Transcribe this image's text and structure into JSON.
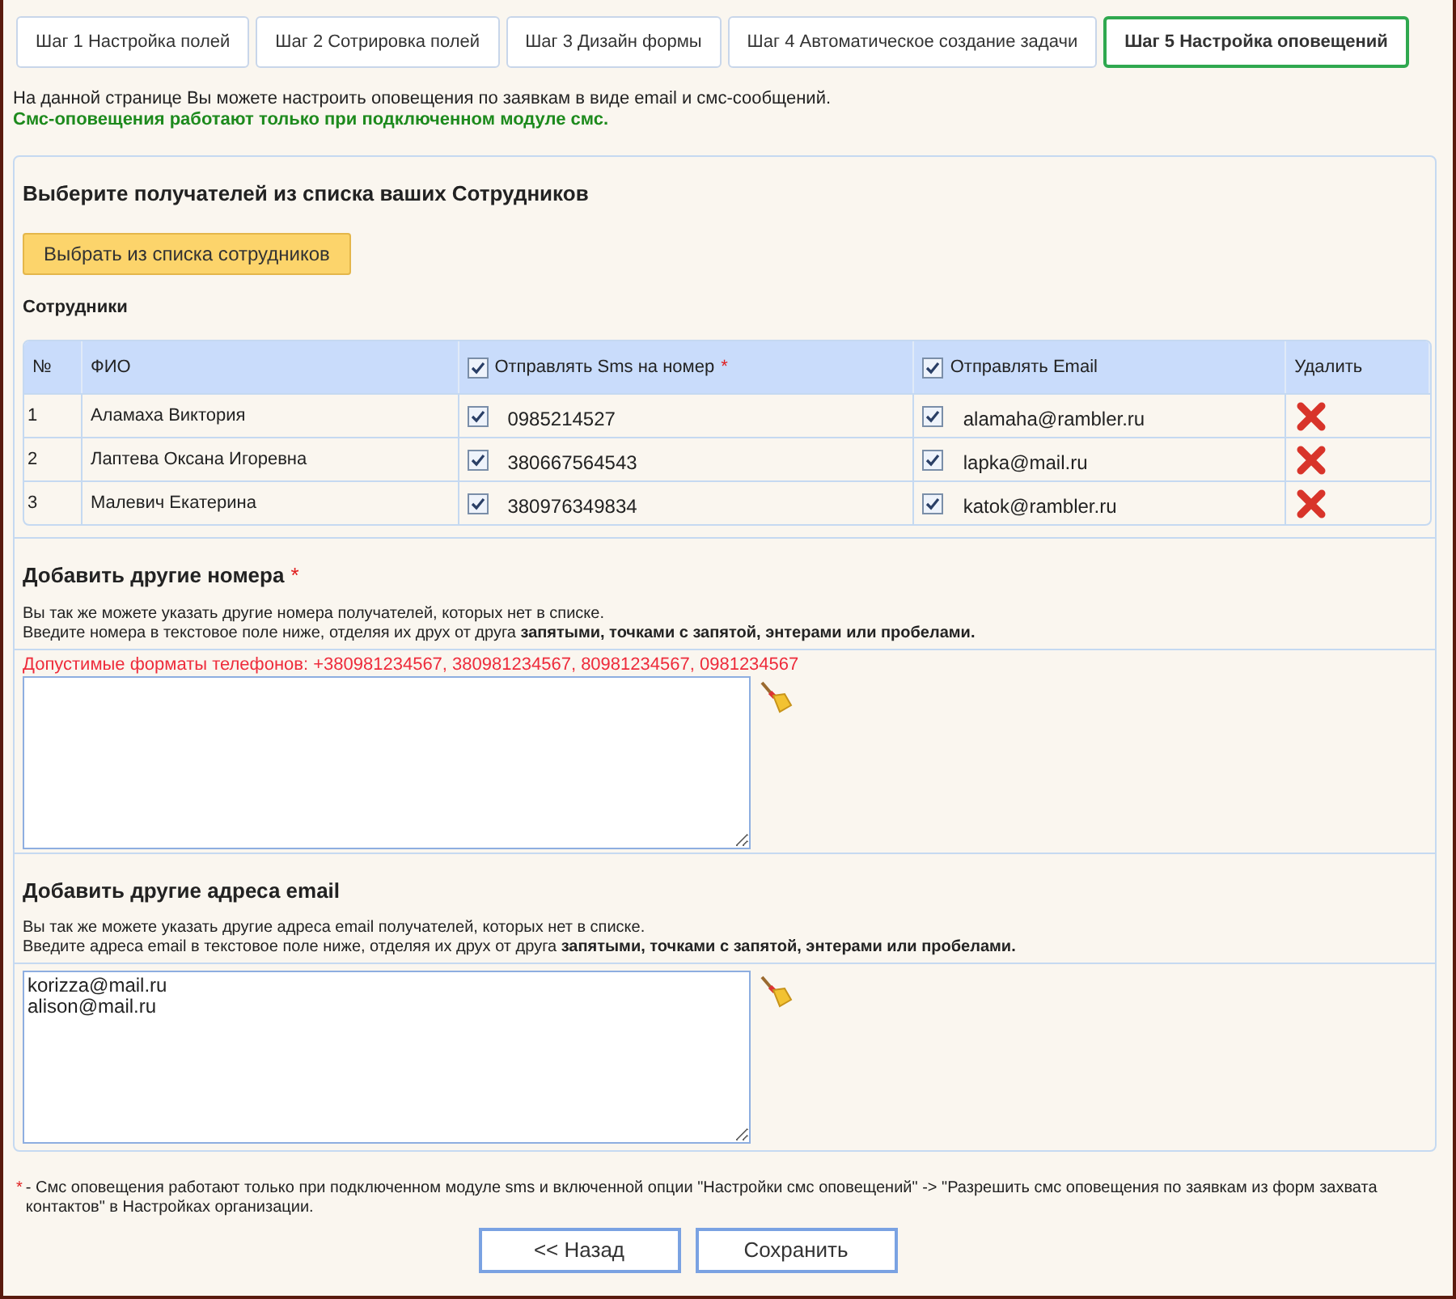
{
  "tabs": [
    {
      "label": "Шаг 1 Настройка полей",
      "selected": false
    },
    {
      "label": "Шаг 2 Сотрировка полей",
      "selected": false
    },
    {
      "label": "Шаг 3 Дизайн формы",
      "selected": false
    },
    {
      "label": "Шаг 4 Автоматическое создание задачи",
      "selected": false
    },
    {
      "label": "Шаг 5 Настройка оповещений",
      "selected": true
    }
  ],
  "intro": {
    "text": "На данной странице Вы можете настроить оповещения по заявкам в виде email и смс-сообщений.",
    "warning": "Смс-оповещения работают только при подключенном модуле смс."
  },
  "recipients": {
    "heading": "Выберите получателей из списка ваших Сотрудников",
    "pick_button": "Выбрать из списка сотрудников",
    "table_title": "Сотрудники",
    "columns": [
      {
        "label": "№"
      },
      {
        "label": "ФИО"
      },
      {
        "label": "Отправлять Sms на номер",
        "required_mark": "*",
        "checked": true
      },
      {
        "label": "Отправлять Email",
        "checked": true
      },
      {
        "label": "Удалить"
      }
    ],
    "rows": [
      {
        "number": "1",
        "name": "Аламаха Виктория",
        "sms_checked": true,
        "phone": "0985214527",
        "email_checked": true,
        "email": "alamaha@rambler.ru"
      },
      {
        "number": "2",
        "name": "Лаптева Оксана Игоревна",
        "sms_checked": true,
        "phone": "380667564543",
        "email_checked": true,
        "email": "lapka@mail.ru"
      },
      {
        "number": "3",
        "name": "Малевич Екатерина",
        "sms_checked": true,
        "phone": "380976349834",
        "email_checked": true,
        "email": "katok@rambler.ru"
      }
    ]
  },
  "phones": {
    "heading": "Добавить другие номера",
    "required_mark": "*",
    "description": [
      "Вы так же можете указать другие номера получателей, которых нет в списке.",
      "Введите номера в текстовое поле ниже, отделяя их друх от друга **запятыми, точками с запятой, энтерами или пробелами.**"
    ],
    "formats": "Допустимые форматы телефонов: +380981234567, 380981234567, 80981234567, 0981234567"
  },
  "emails": {
    "heading": "Добавить другие адреса email",
    "description": [
      "Вы так же можете указать другие адреса email получателей, которых нет в списке.",
      "Введите адреса email в текстовое поле ниже, отделяя их друх от друга **запятыми, точками с запятой, энтерами или пробелами.**"
    ],
    "value": "korizza@mail.ru\nalison@mail.ru"
  },
  "footnote": {
    "mark": "*",
    "text": " - Смс оповещения работают только при подключенном модуле sms и включенной опции \"Настройки смс оповещений\" -> \"Разрешить смс оповещения по заявкам из форм захвата контактов\" в Настройках организации."
  },
  "buttons": [
    "<< Назад",
    "Сохранить"
  ]
}
